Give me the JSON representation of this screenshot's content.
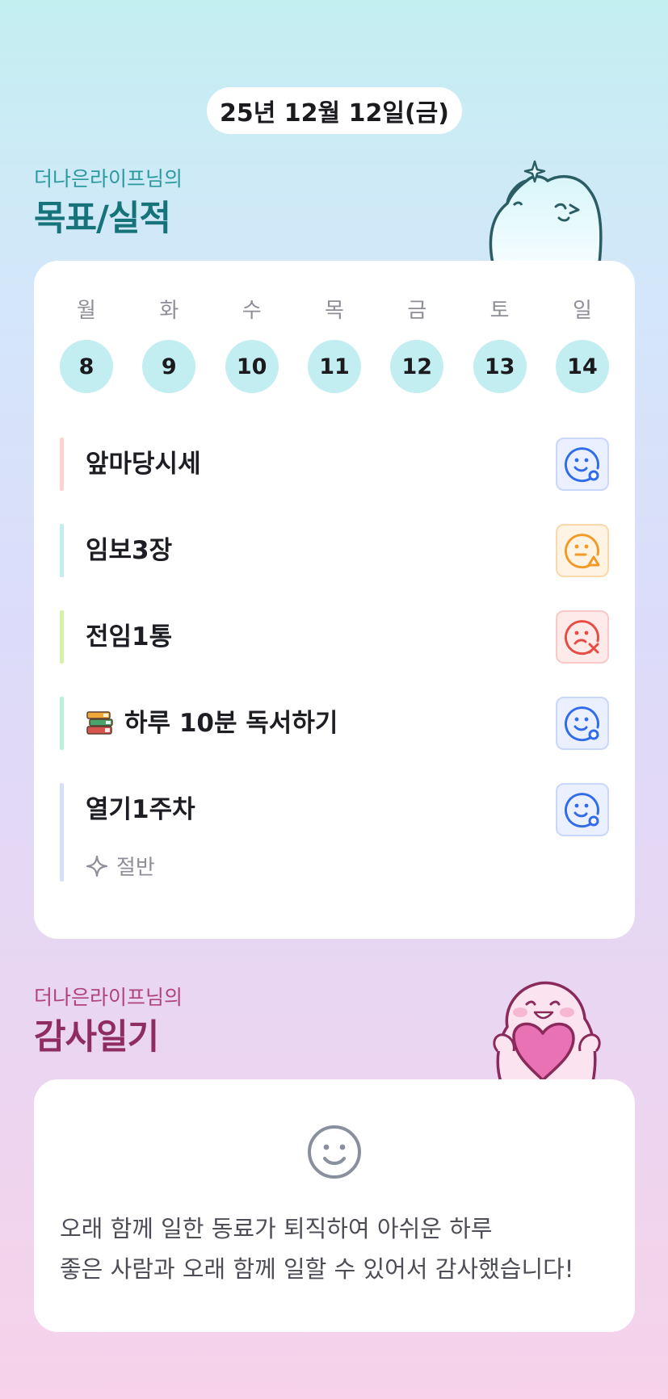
{
  "date": "25년 12월 12일(금)",
  "goals_section": {
    "subtitle": "더나은라이프님의",
    "title": "목표/실적"
  },
  "week": [
    {
      "day": "월",
      "date": "8"
    },
    {
      "day": "화",
      "date": "9"
    },
    {
      "day": "수",
      "date": "10"
    },
    {
      "day": "목",
      "date": "11"
    },
    {
      "day": "금",
      "date": "12"
    },
    {
      "day": "토",
      "date": "13"
    },
    {
      "day": "일",
      "date": "14"
    }
  ],
  "goals": [
    {
      "text": "앞마당시세",
      "status": "o",
      "bar_color": "#fcd3d0",
      "icon": "smile-o-icon"
    },
    {
      "text": "임보3장",
      "status": "triangle",
      "bar_color": "#c3eef1",
      "icon": "neutral-triangle-icon"
    },
    {
      "text": "전임1통",
      "status": "x",
      "bar_color": "#d6f1a8",
      "icon": "sad-x-icon"
    },
    {
      "text": "하루 10분 독서하기",
      "status": "o",
      "bar_color": "#bdf0da",
      "icon": "smile-o-icon",
      "prefix_icon": "books-icon"
    },
    {
      "text": "열기1주차",
      "status": "o",
      "bar_color": "#d6def8",
      "icon": "smile-o-icon",
      "note": "절반",
      "note_icon": "sparkle-icon"
    }
  ],
  "status_colors": {
    "o": "#2f6bea",
    "triangle": "#f39a26",
    "x": "#e64b44"
  },
  "diary_section": {
    "subtitle": "더나은라이프님의",
    "title": "감사일기",
    "lines": [
      "오래 함께 일한 동료가 퇴직하여 아쉬운 하루",
      "좋은 사람과 오래 함께 일할 수 있어서 감사했습니다!"
    ],
    "face_icon": "smile-face-icon"
  }
}
